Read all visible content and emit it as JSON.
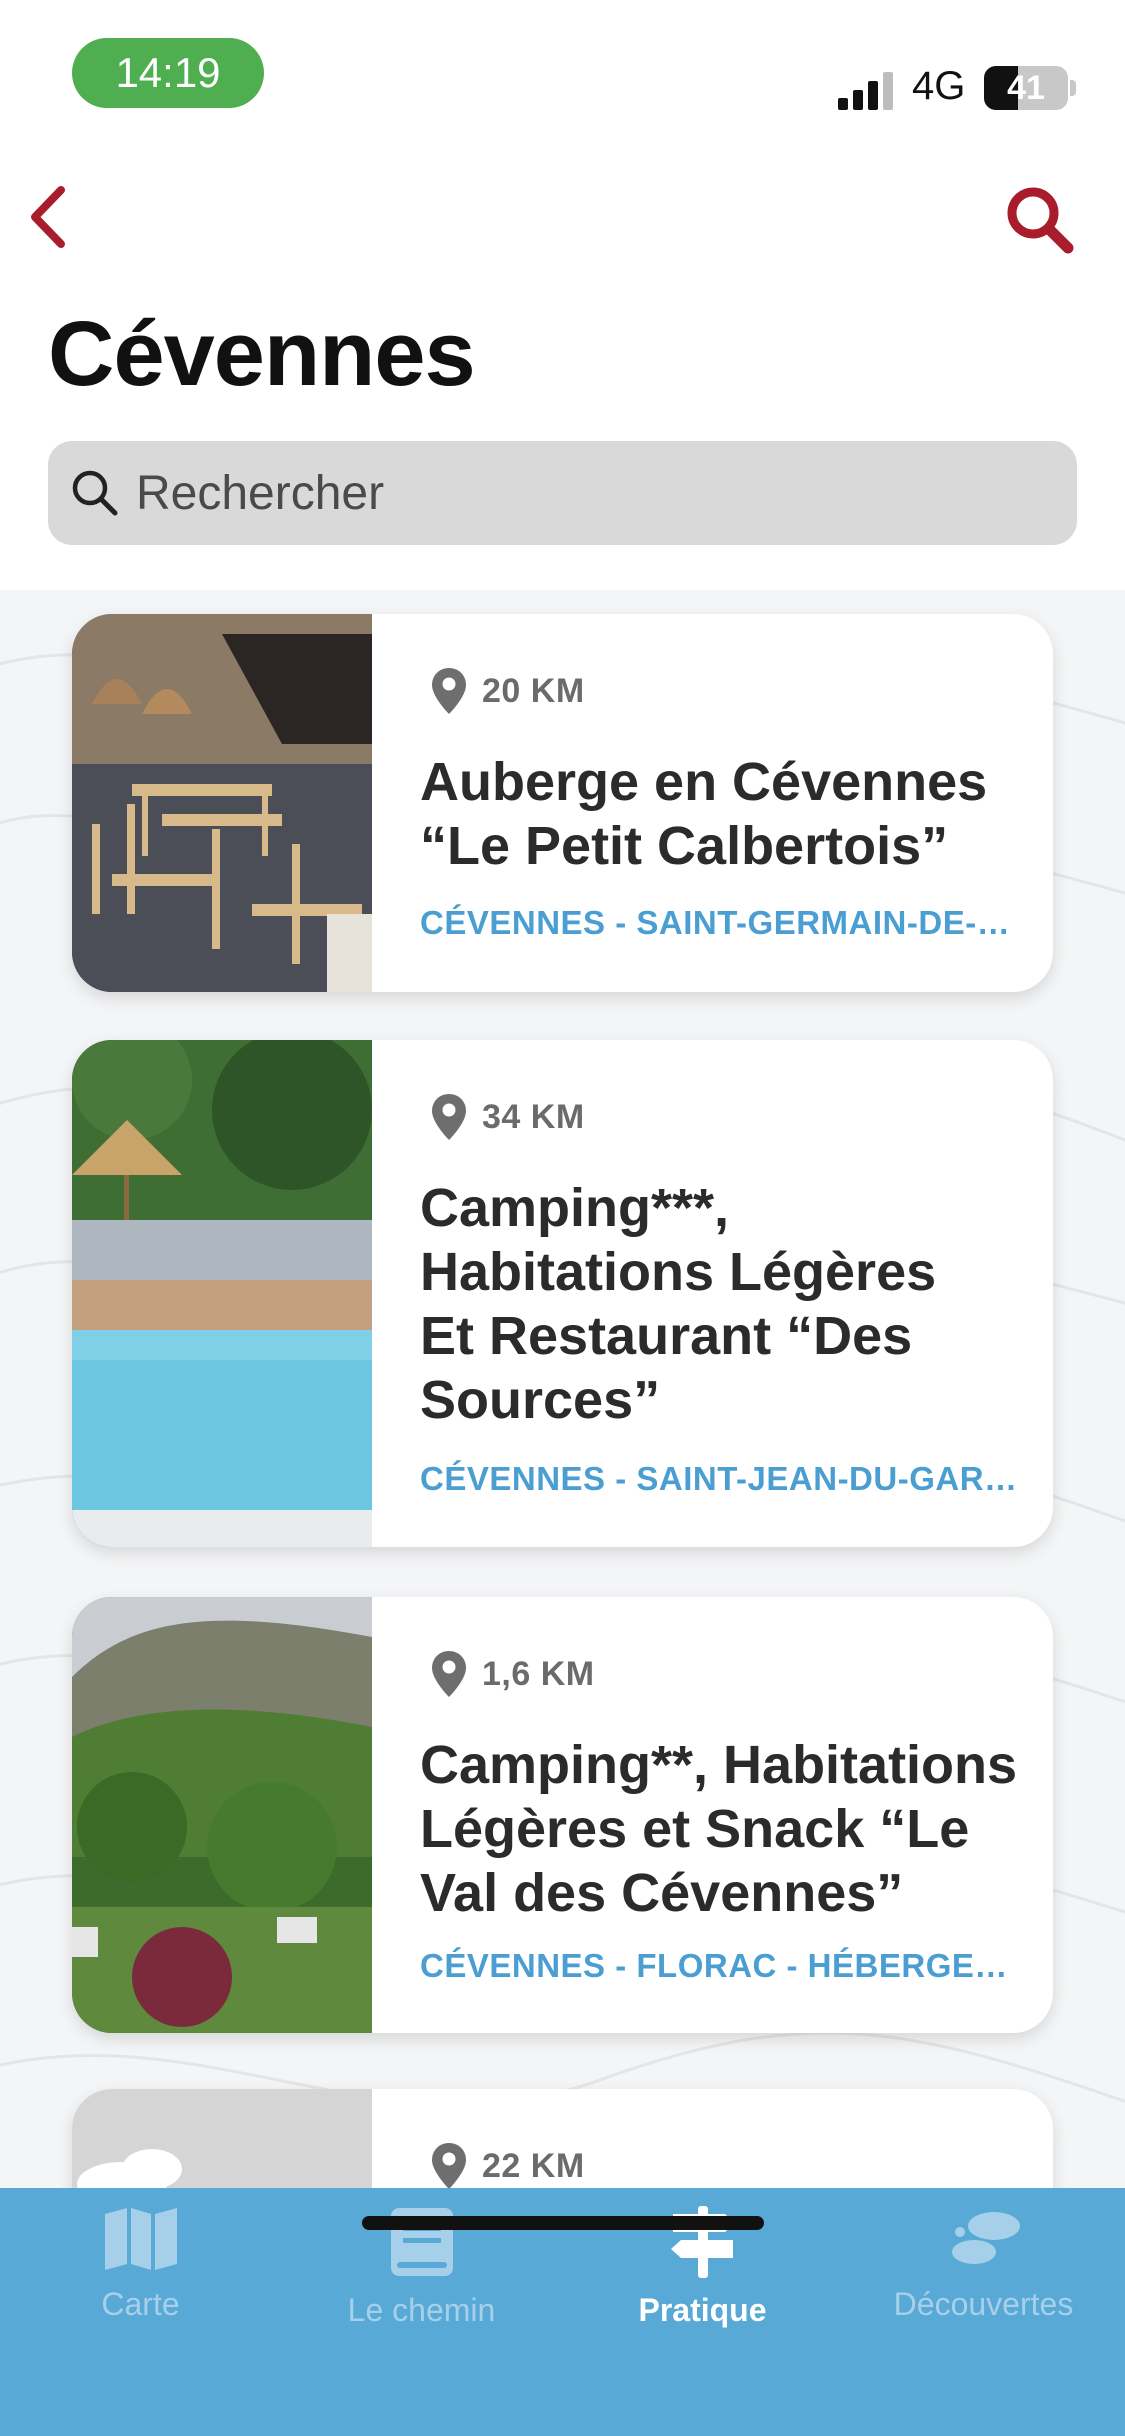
{
  "status_bar": {
    "time": "14:19",
    "network": "4G",
    "battery": "41",
    "battery_level": 0.41
  },
  "header": {
    "title": "Cévennes",
    "back_icon": "chevron-left-icon",
    "search_icon": "search-icon"
  },
  "search": {
    "placeholder": "Rechercher"
  },
  "colors": {
    "accent_red": "#a81c2c",
    "tag_blue": "#4a9ed2",
    "tab_bar": "#58a9d6"
  },
  "cards": [
    {
      "distance": "20 KM",
      "title": "Auberge en Cévennes “Le Petit Calbertois”",
      "tags": "CÉVENNES - SAINT-GERMAIN-DE-CALBERTE - RESTAURANT"
    },
    {
      "distance": "34 KM",
      "title": "Camping***, Habitations Légères Et Restaurant “Des Sources”",
      "tags": "CÉVENNES - SAINT-JEAN-DU-GARD - HÉBERGEMENT"
    },
    {
      "distance": "1,6 KM",
      "title": "Camping**, Habitations Légères et Snack “Le Val des Cévennes”",
      "tags": "CÉVENNES - FLORAC - HÉBERGEMENT"
    },
    {
      "distance": "22 KM"
    }
  ],
  "tabs": [
    {
      "label": "Carte",
      "icon": "map-icon"
    },
    {
      "label": "Le chemin",
      "icon": "book-icon"
    },
    {
      "label": "Pratique",
      "icon": "signpost-icon",
      "active": true
    },
    {
      "label": "Découvertes",
      "icon": "footprints-icon"
    }
  ]
}
